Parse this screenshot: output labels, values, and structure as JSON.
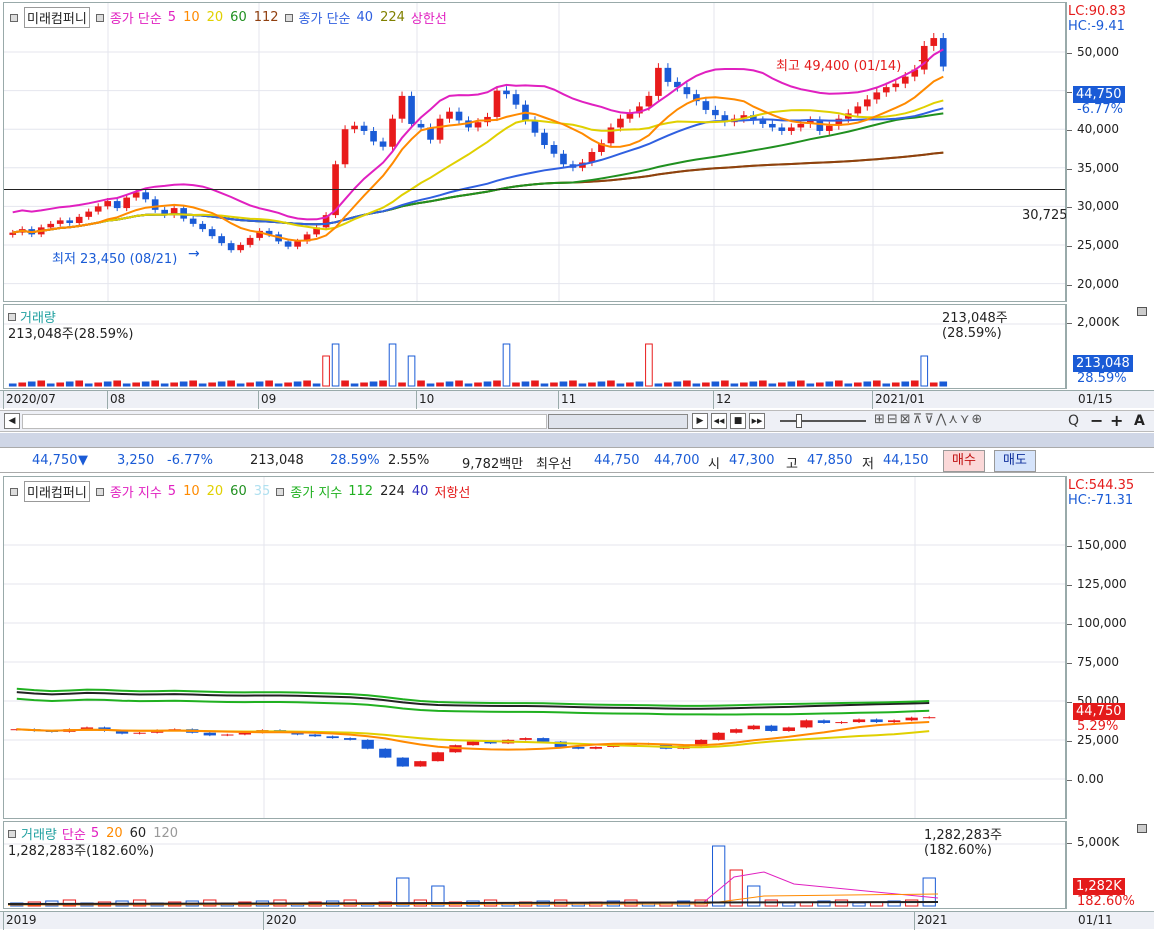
{
  "top_chart": {
    "legend": {
      "name": "미래컴퍼니",
      "ma_prefix": "종가 단순",
      "ma_periods": [
        "5",
        "10",
        "20",
        "60",
        "112"
      ],
      "ma_colors": [
        "#e020c0",
        "#ff8a00",
        "#e0d000",
        "#209020",
        "#904010"
      ],
      "ma2_prefix": "종가 단순",
      "ma2_periods": [
        "40",
        "224"
      ],
      "ma2_colors": [
        "#3060e0",
        "#808000"
      ],
      "upper_limit": "상한선"
    },
    "lc": "LC:90.83",
    "hc": "HC:-9.41",
    "y_labels": [
      "50,000",
      "45,000",
      "40,000",
      "35,000",
      "30,000",
      "25,000",
      "20,000"
    ],
    "current_price": "44,750",
    "current_change": "-6.77%",
    "ref_line": "30,725",
    "high_annotation": "최고 49,400 (01/14)",
    "low_annotation": "최저 23,450 (08/21)",
    "volume": {
      "title": "거래량",
      "sub_label": "213,048주(28.59%)",
      "right_label": "213,048주(28.59%)",
      "y_label": "2,000K",
      "badge_value": "213,048",
      "badge_pct": "28.59%"
    },
    "x_labels": [
      "2020/07",
      "08",
      "09",
      "10",
      "11",
      "12",
      "2021/01"
    ],
    "x_end": "01/15",
    "colors": {
      "up": "#e81b1b",
      "down": "#1a5bd6"
    },
    "chart_data": {
      "type": "candlestick",
      "title": "",
      "ylim": [
        18000,
        52000
      ],
      "x_ticks": [
        "2020/07",
        "08",
        "09",
        "10",
        "11",
        "12",
        "2021/01"
      ],
      "close": [
        25800,
        26200,
        25600,
        26400,
        26800,
        27200,
        26900,
        27600,
        28200,
        28800,
        29400,
        28600,
        29800,
        30400,
        29600,
        28400,
        27800,
        28600,
        27400,
        26800,
        26200,
        25400,
        24600,
        23800,
        24400,
        25200,
        26000,
        25600,
        24800,
        24200,
        24800,
        25600,
        26400,
        27800,
        33600,
        37600,
        38000,
        37400,
        36200,
        35600,
        38800,
        41400,
        38200,
        37800,
        36400,
        38800,
        39600,
        38600,
        37800,
        38400,
        39000,
        42000,
        41600,
        40400,
        38600,
        37200,
        35800,
        34800,
        33600,
        33200,
        33800,
        35000,
        36000,
        37800,
        38800,
        39400,
        40200,
        41400,
        44600,
        43000,
        42400,
        41600,
        40800,
        39800,
        39200,
        38400,
        38800,
        39200,
        38600,
        38200,
        37800,
        37400,
        37800,
        38200,
        38600,
        37400,
        38000,
        38800,
        39400,
        40200,
        41000,
        41800,
        42400,
        42800,
        43600,
        44400,
        47100,
        48000,
        44750
      ],
      "price_labels": [
        "50,000",
        "45,000",
        "40,000",
        "35,000",
        "30,000",
        "25,000",
        "20,000"
      ],
      "high": {
        "label": "최고 49,400 (01/14)",
        "value": 49400
      },
      "low": {
        "label": "최저 23,450 (08/21)",
        "value": 23450
      }
    }
  },
  "toolbar": {
    "scroll_left": "◀",
    "play": "▶",
    "rewind": "◀◀",
    "stop": "■",
    "ffwd": "▶▶",
    "minus": "−",
    "plus": "+",
    "text_tool": "A",
    "search": "Q"
  },
  "info_bar": {
    "price": "44,750",
    "arrow": "▼",
    "change": "3,250",
    "change_pct": "-6.77%",
    "volume": "213,048",
    "turnover_pct": "28.59%",
    "ratio": "2.55%",
    "amount": "9,782백만",
    "best_quote_label": "최우선",
    "ask": "44,750",
    "bid": "44,700",
    "open_label": "시",
    "open": "47,300",
    "high_label": "고",
    "high": "47,850",
    "low_label": "저",
    "low": "44,150",
    "buy": "매수",
    "sell": "매도"
  },
  "bottom_chart": {
    "legend": {
      "name": "미래컴퍼니",
      "ma_prefix": "종가 지수",
      "ma_periods": [
        "5",
        "10",
        "20",
        "60",
        "35"
      ],
      "ma_colors": [
        "#e020c0",
        "#ff8a00",
        "#e0d000",
        "#209020",
        "#b0e0f0"
      ],
      "ma2_prefix": "종가 지수",
      "ma2_periods": [
        "112",
        "224",
        "40"
      ],
      "ma2_colors": [
        "#20b020",
        "#222222",
        "#3030c0"
      ],
      "lower_limit": "저항선"
    },
    "lc": "LC:544.35",
    "hc": "HC:-71.31",
    "y_labels": [
      "150,000",
      "125,000",
      "100,000",
      "75,000",
      "50,000",
      "25,000",
      "0.00"
    ],
    "current_price": "44,750",
    "current_change": "5.29%",
    "volume": {
      "title": "거래량",
      "ma_prefix": "단순",
      "ma_periods": [
        "5",
        "20",
        "60",
        "120"
      ],
      "ma_colors": [
        "#e020c0",
        "#ff8a00",
        "#222222",
        "#999999"
      ],
      "sub_label": "1,282,283주(182.60%)",
      "right_label": "1,282,283주(182.60%)",
      "y_label": "5,000K",
      "badge_value": "1,282K",
      "badge_pct": "182.60%"
    },
    "x_labels": [
      "2019",
      "2020",
      "2021"
    ],
    "x_end": "01/11",
    "chart_data": {
      "type": "candlestick",
      "title": "",
      "ylim": [
        -12000,
        180000
      ],
      "x_ticks": [
        "2019",
        "2020",
        "2021"
      ],
      "close": [
        38000,
        37000,
        36500,
        38000,
        39000,
        37000,
        35500,
        36000,
        37500,
        38000,
        36000,
        34500,
        35000,
        36000,
        37500,
        36500,
        35000,
        34000,
        33000,
        32000,
        27000,
        22000,
        17000,
        20000,
        25000,
        29000,
        31000,
        30000,
        32000,
        33000,
        31000,
        28000,
        27000,
        28000,
        29000,
        30000,
        29500,
        27000,
        28500,
        32000,
        36000,
        38000,
        40000,
        37000,
        39000,
        43000,
        41500,
        42000,
        43500,
        42000,
        43000,
        44500,
        44750
      ],
      "price_labels": [
        "150,000",
        "125,000",
        "100,000",
        "75,000",
        "50,000",
        "25,000",
        "0.00"
      ]
    }
  }
}
